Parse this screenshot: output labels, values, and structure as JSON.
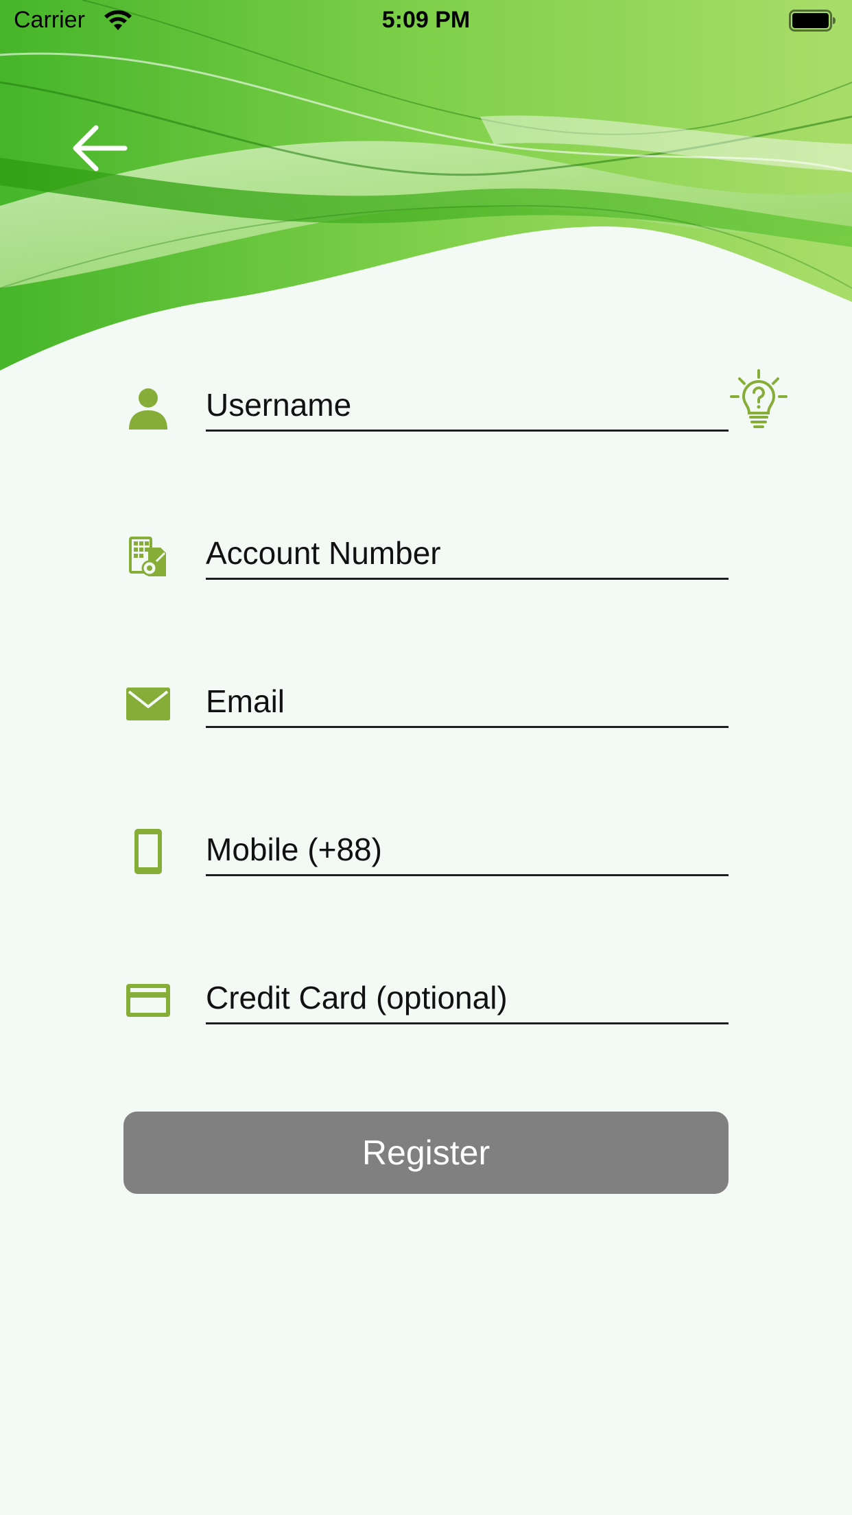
{
  "status_bar": {
    "carrier": "Carrier",
    "time": "5:09 PM",
    "icons": [
      "wifi-icon",
      "battery-icon"
    ]
  },
  "header": {
    "back_icon": "arrow-left-icon",
    "hint_icon": "lightbulb-question-icon"
  },
  "form": {
    "fields": [
      {
        "placeholder": "Username",
        "value": "",
        "icon": "person-icon"
      },
      {
        "placeholder": "Account Number",
        "value": "",
        "icon": "account-document-icon"
      },
      {
        "placeholder": "Email",
        "value": "",
        "icon": "envelope-icon"
      },
      {
        "placeholder": "Mobile (+88)",
        "value": "",
        "icon": "mobile-phone-icon"
      },
      {
        "placeholder": "Credit Card (optional)",
        "value": "",
        "icon": "credit-card-icon"
      }
    ],
    "submit_label": "Register"
  },
  "colors": {
    "background": "#f3f9f5",
    "accent_green": "#86ad37",
    "header_green": "#5cc433",
    "input_underline": "#1d1d1d",
    "button_background": "#808080",
    "button_text": "#ffffff"
  }
}
